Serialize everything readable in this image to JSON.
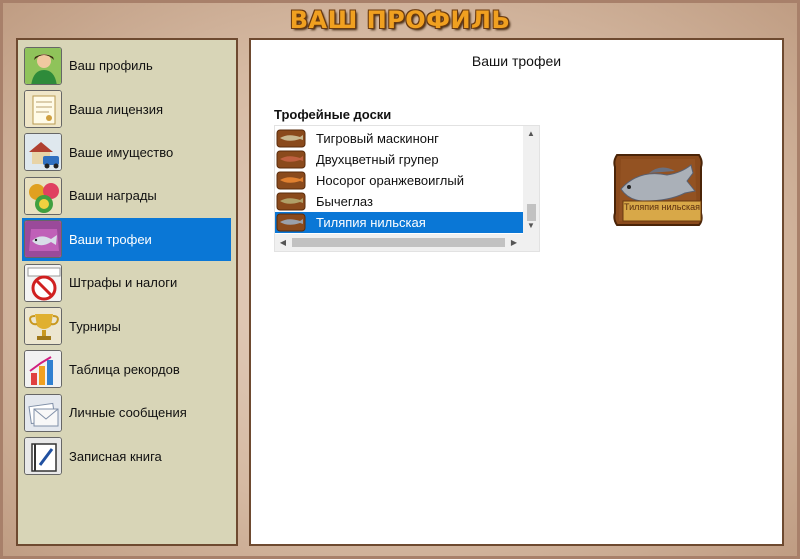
{
  "header": {
    "title": "ВАШ ПРОФИЛЬ"
  },
  "sidebar": {
    "items": [
      {
        "label": "Ваш профиль",
        "icon": "user-profile-icon"
      },
      {
        "label": "Ваша лицензия",
        "icon": "license-icon"
      },
      {
        "label": "Ваше имущество",
        "icon": "property-icon"
      },
      {
        "label": "Ваши награды",
        "icon": "awards-icon"
      },
      {
        "label": "Ваши трофеи",
        "icon": "trophy-fish-icon",
        "active": true
      },
      {
        "label": "Штрафы и налоги",
        "icon": "fines-icon"
      },
      {
        "label": "Турниры",
        "icon": "tournament-cup-icon"
      },
      {
        "label": "Таблица рекордов",
        "icon": "records-chart-icon"
      },
      {
        "label": "Личные сообщения",
        "icon": "messages-icon"
      },
      {
        "label": "Записная книга",
        "icon": "notebook-icon"
      }
    ]
  },
  "main": {
    "title": "Ваши трофеи",
    "boards_label": "Трофейные доски",
    "boards": [
      {
        "label": "Тигровый маскинонг"
      },
      {
        "label": "Двухцветный групер"
      },
      {
        "label": "Носорог оранжевоиглый"
      },
      {
        "label": "Бычеглаз"
      },
      {
        "label": "Тиляпия нильская",
        "selected": true
      }
    ],
    "preview": {
      "plaque_text": "Тиляпия нильская"
    }
  },
  "colors": {
    "selection": "#0a77d6",
    "sidebar_bg": "#d8d5b7",
    "title": "#f0a020"
  }
}
